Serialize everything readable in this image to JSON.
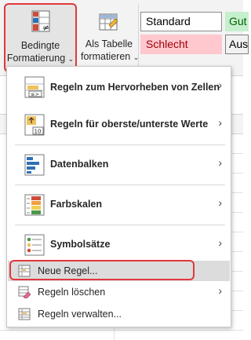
{
  "ribbon": {
    "conditional_formatting": {
      "line1": "Bedingte",
      "line2": "Formatierung",
      "chevron": "⌄"
    },
    "format_as_table": {
      "line1": "Als Tabelle",
      "line2": "formatieren",
      "chevron": "⌄"
    },
    "styles": {
      "standard": "Standard",
      "gut": "Gut",
      "schlecht": "Schlecht",
      "ausgabe": "Aus"
    }
  },
  "menu": {
    "items": [
      {
        "label": "Regeln zum Hervorheben von Zellen",
        "icon": "highlight-cells-rules-icon",
        "submenu": true
      },
      {
        "label": "Regeln für oberste/unterste Werte",
        "icon": "top-bottom-rules-icon",
        "submenu": true
      },
      {
        "label": "Datenbalken",
        "icon": "data-bars-icon",
        "submenu": true
      },
      {
        "label": "Farbskalen",
        "icon": "color-scales-icon",
        "submenu": true
      },
      {
        "label": "Symbolsätze",
        "icon": "icon-sets-icon",
        "submenu": true
      },
      {
        "label": "Neue Regel...",
        "icon": "new-rule-icon",
        "submenu": false,
        "highlighted": true
      },
      {
        "label": "Regeln löschen",
        "icon": "clear-rules-icon",
        "submenu": true
      },
      {
        "label": "Regeln verwalten...",
        "icon": "manage-rules-icon",
        "submenu": false
      }
    ],
    "arrow": "›",
    "icon_text_10": "10"
  },
  "colors": {
    "highlight_frame": "#e0373c",
    "menu_hover": "#dcdcdc",
    "style_good_bg": "#c6efce",
    "style_bad_bg": "#ffc7ce"
  }
}
